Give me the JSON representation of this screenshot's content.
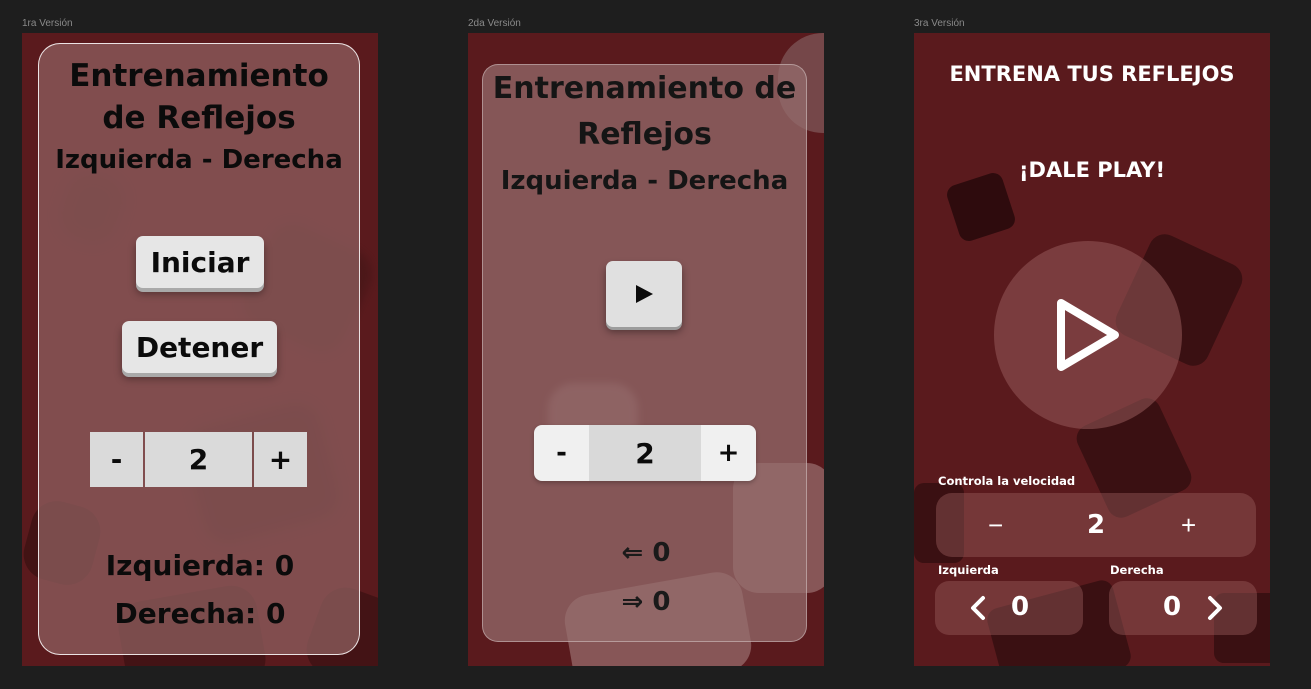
{
  "canvas": {
    "background": "#1e1e1e",
    "frame_background": "#5a1a1d"
  },
  "versions": [
    {
      "label": "1ra Versión",
      "title_line1": "Entrenamiento",
      "title_line2": "de Reflejos",
      "subtitle": "Izquierda - Derecha",
      "start_button": "Iniciar",
      "stop_button": "Detener",
      "stepper": {
        "minus": "-",
        "value": "2",
        "plus": "+"
      },
      "left_score": "Izquierda: 0",
      "right_score": "Derecha: 0"
    },
    {
      "label": "2da Versión",
      "title_line1": "Entrenamiento de",
      "title_line2": "Reflejos",
      "subtitle": "Izquierda - Derecha",
      "play_icon": "play-icon",
      "stepper": {
        "minus": "-",
        "value": "2",
        "plus": "+"
      },
      "left_score": "⇐ 0",
      "right_score": "⇒ 0"
    },
    {
      "label": "3ra Versión",
      "title": "ENTRENA TUS REFLEJOS",
      "cta": "¡DALE PLAY!",
      "play_icon": "play-outline-icon",
      "speed_label": "Controla la velocidad",
      "stepper": {
        "minus": "−",
        "value": "2",
        "plus": "+"
      },
      "left_label": "Izquierda",
      "left_value": "0",
      "right_label": "Derecha",
      "right_value": "0"
    }
  ]
}
